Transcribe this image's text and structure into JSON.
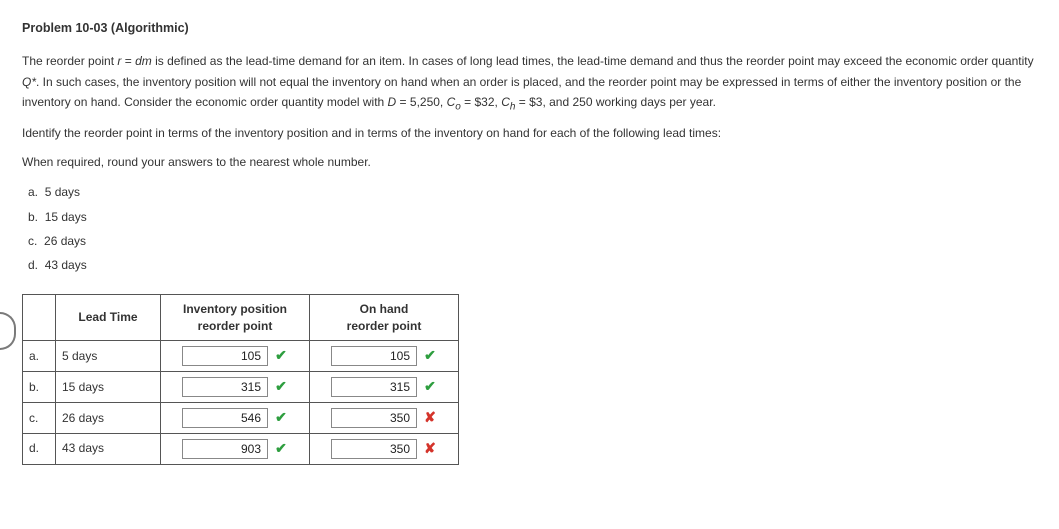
{
  "title": "Problem 10-03 (Algorithmic)",
  "paragraph_parts": {
    "p1a": "The reorder point ",
    "p1b": " is defined as the lead-time demand for an item. In cases of long lead times, the lead-time demand and thus the reorder point may exceed the economic order quantity ",
    "p1c": ". In such cases, the inventory position will not equal the inventory on hand when an order is placed, and the reorder point may be expressed in terms of either the inventory position or the inventory on hand. Consider the economic order quantity model with ",
    "p1d": " = 5,250, ",
    "p1e": " = $32, ",
    "p1f": " = $3, and 250 working days per year.",
    "eq_r": "r",
    "eq_equals": " = ",
    "eq_dm": "dm",
    "Qstar": "Q*",
    "D": "D",
    "Co": "C",
    "Co_sub": "o",
    "Ch": "C",
    "Ch_sub": "h"
  },
  "instruction1": "Identify the reorder point in terms of the inventory position and in terms of the inventory on hand for each of the following lead times:",
  "instruction2": "When required, round your answers to the nearest whole number.",
  "options": [
    {
      "label": "a.",
      "text": "5 days"
    },
    {
      "label": "b.",
      "text": "15 days"
    },
    {
      "label": "c.",
      "text": "26 days"
    },
    {
      "label": "d.",
      "text": "43 days"
    }
  ],
  "table": {
    "headers": {
      "lead": "Lead Time",
      "inv_pos_l1": "Inventory position",
      "inv_pos_l2": "reorder point",
      "onhand_l1": "On hand",
      "onhand_l2": "reorder point"
    },
    "rows": [
      {
        "letter": "a.",
        "lead": "5 days",
        "inv_pos": "105",
        "inv_pos_ok": true,
        "onhand": "105",
        "onhand_ok": true
      },
      {
        "letter": "b.",
        "lead": "15 days",
        "inv_pos": "315",
        "inv_pos_ok": true,
        "onhand": "315",
        "onhand_ok": true
      },
      {
        "letter": "c.",
        "lead": "26 days",
        "inv_pos": "546",
        "inv_pos_ok": true,
        "onhand": "350",
        "onhand_ok": false
      },
      {
        "letter": "d.",
        "lead": "43 days",
        "inv_pos": "903",
        "inv_pos_ok": true,
        "onhand": "350",
        "onhand_ok": false
      }
    ]
  },
  "marks": {
    "correct": "✔",
    "wrong": "✘"
  }
}
